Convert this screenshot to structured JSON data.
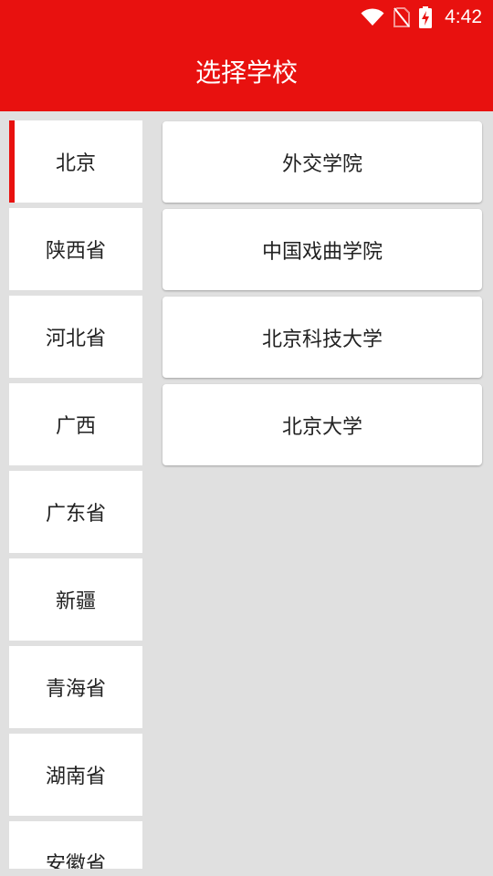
{
  "status_bar": {
    "time": "4:42",
    "icons": [
      "wifi-icon",
      "no-sim-icon",
      "battery-charging-icon"
    ]
  },
  "header": {
    "title": "选择学校"
  },
  "colors": {
    "accent": "#e8110f",
    "background": "#e0e0e0",
    "card": "#ffffff"
  },
  "provinces": [
    {
      "label": "北京",
      "selected": true
    },
    {
      "label": "陕西省",
      "selected": false
    },
    {
      "label": "河北省",
      "selected": false
    },
    {
      "label": "广西",
      "selected": false
    },
    {
      "label": "广东省",
      "selected": false
    },
    {
      "label": "新疆",
      "selected": false
    },
    {
      "label": "青海省",
      "selected": false
    },
    {
      "label": "湖南省",
      "selected": false
    },
    {
      "label": "安徽省",
      "selected": false
    }
  ],
  "schools": [
    {
      "label": "外交学院"
    },
    {
      "label": "中国戏曲学院"
    },
    {
      "label": "北京科技大学"
    },
    {
      "label": "北京大学"
    }
  ]
}
